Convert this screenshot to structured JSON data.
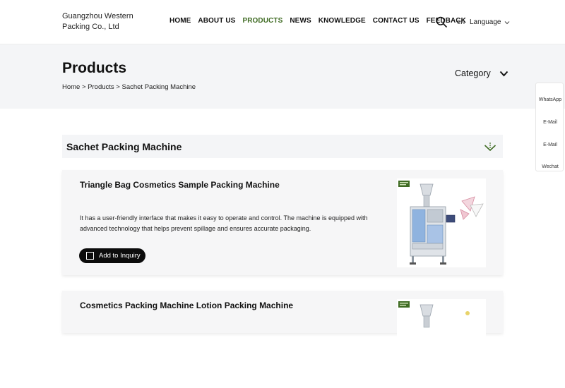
{
  "header": {
    "company_name": "Guangzhou Western Packing Co., Ltd",
    "nav": [
      "HOME",
      "ABOUT US",
      "PRODUCTS",
      "NEWS",
      "KNOWLEDGE",
      "CONTACT US",
      "FEEDBACK"
    ],
    "active_nav": "PRODUCTS",
    "lang_code": "en",
    "language_label": "Language"
  },
  "banner": {
    "title": "Products",
    "breadcrumb": "Home > Products > Sachet Packing Machine",
    "category_label": "Category"
  },
  "side_widget": {
    "items": [
      "WhatsApp",
      "E-Mail",
      "E-Mail",
      "Wechat"
    ]
  },
  "section": {
    "title": "Sachet Packing Machine"
  },
  "products": [
    {
      "title": "Triangle Bag Cosmetics Sample Packing Machine",
      "description": "It has a user-friendly interface that makes it easy to operate and control. The machine is equipped with advanced technology that helps prevent spillage and ensures accurate packaging.",
      "button_label": "Add to Inquiry"
    },
    {
      "title": "Cosmetics Packing Machine Lotion Packing Machine"
    }
  ],
  "colors": {
    "active_nav": "#3f6b23",
    "banner_bg": "#f4f5f7",
    "button_bg": "#0c0c0c"
  }
}
